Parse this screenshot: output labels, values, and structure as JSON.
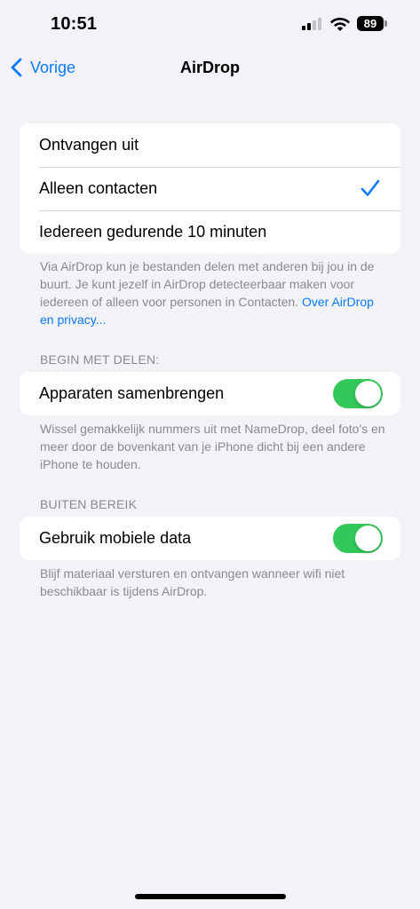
{
  "status_bar": {
    "time": "10:51",
    "battery": "89"
  },
  "nav": {
    "back_label": "Vorige",
    "title": "AirDrop"
  },
  "receive_options": {
    "items": [
      {
        "label": "Ontvangen uit",
        "selected": false
      },
      {
        "label": "Alleen contacten",
        "selected": true
      },
      {
        "label": "Iedereen gedurende 10 minuten",
        "selected": false
      }
    ],
    "footnote_text": "Via AirDrop kun je bestanden delen met anderen bij jou in de buurt. Je kunt jezelf in AirDrop detecteerbaar maken voor iedereen of alleen voor personen in Contacten. ",
    "footnote_link": "Over AirDrop en privacy..."
  },
  "begin_sharing": {
    "header": "BEGIN MET DELEN:",
    "toggle_label": "Apparaten samenbrengen",
    "toggle_on": true,
    "footnote": "Wissel gemakkelijk nummers uit met NameDrop, deel foto's en meer door de bovenkant van je iPhone dicht bij een andere iPhone te houden."
  },
  "out_of_range": {
    "header": "BUITEN BEREIK",
    "toggle_label": "Gebruik mobiele data",
    "toggle_on": true,
    "footnote": "Blijf materiaal versturen en ontvangen wanneer wifi niet beschikbaar is tijdens AirDrop."
  },
  "colors": {
    "accent": "#0a7aff",
    "toggle_on": "#34c759",
    "background": "#f2f2f7"
  }
}
